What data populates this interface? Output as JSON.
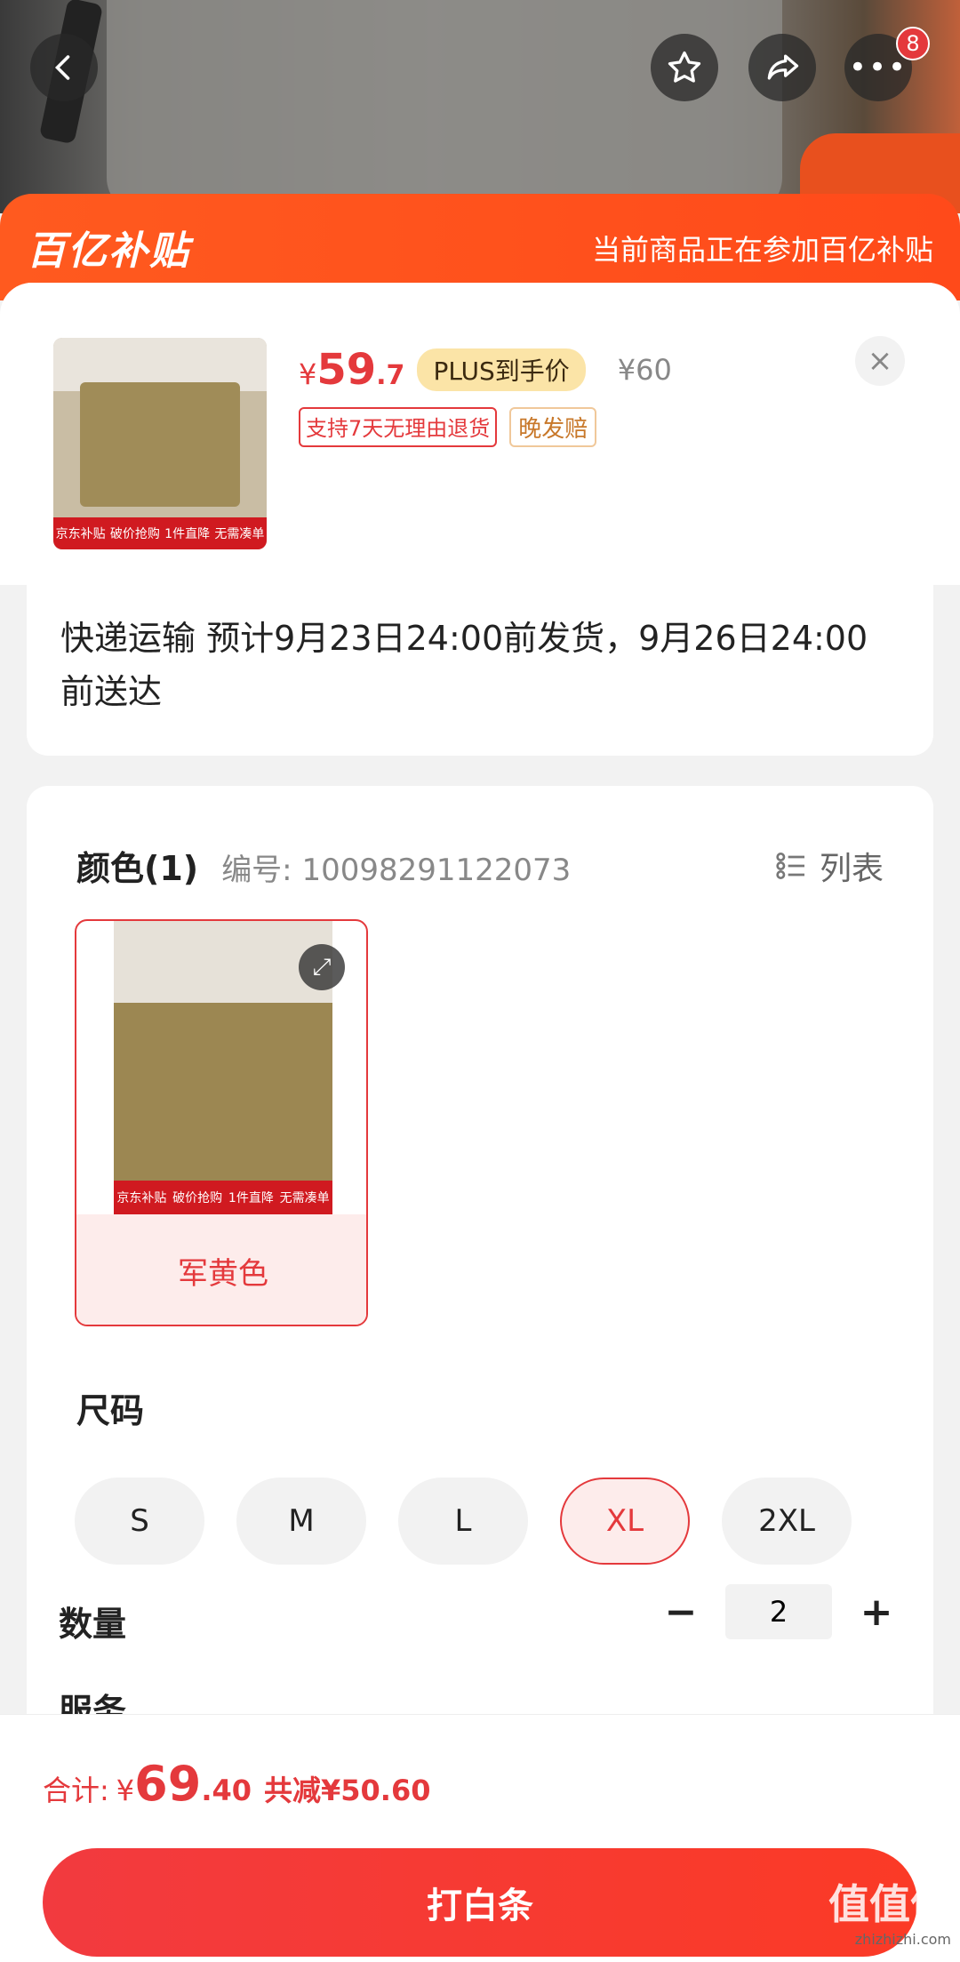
{
  "header": {
    "badge_count": "8"
  },
  "banner": {
    "logo": "百亿补贴",
    "notice": "当前商品正在参加百亿补贴"
  },
  "product": {
    "price_symbol": "¥",
    "price_int": "59",
    "price_dec": ".7",
    "plus_tag": "PLUS到手价",
    "original_price": "¥60",
    "tag_return": "支持7天无理由退货",
    "tag_late": "晚发赔",
    "thumb_strip": [
      "京东补贴",
      "破价抢购",
      "1件直降",
      "无需凑单"
    ],
    "close": "×"
  },
  "delivery": {
    "text": "快递运输 预计9月23日24:00前发货，9月26日24:00前送达"
  },
  "color": {
    "title": "颜色(1)",
    "code": "编号: 10098291122073",
    "list_toggle": "列表",
    "swatch_label": "军黄色"
  },
  "size": {
    "title": "尺码",
    "options": [
      "S",
      "M",
      "L",
      "XL",
      "2XL"
    ],
    "selected": "XL"
  },
  "quantity": {
    "title": "数量",
    "minus": "−",
    "value": "2",
    "plus": "+"
  },
  "service": {
    "title": "服务"
  },
  "footer": {
    "total_label": "合计:",
    "total_symbol": "¥",
    "total_int": "69",
    "total_dec": ".40",
    "saving": "共减¥50.60",
    "pay_button": "打白条",
    "watermark": "值值值",
    "watermark_url": "zhizhizhi.com"
  },
  "colors": {
    "accent": "#e4393c",
    "banner": "#ff5a1f"
  }
}
